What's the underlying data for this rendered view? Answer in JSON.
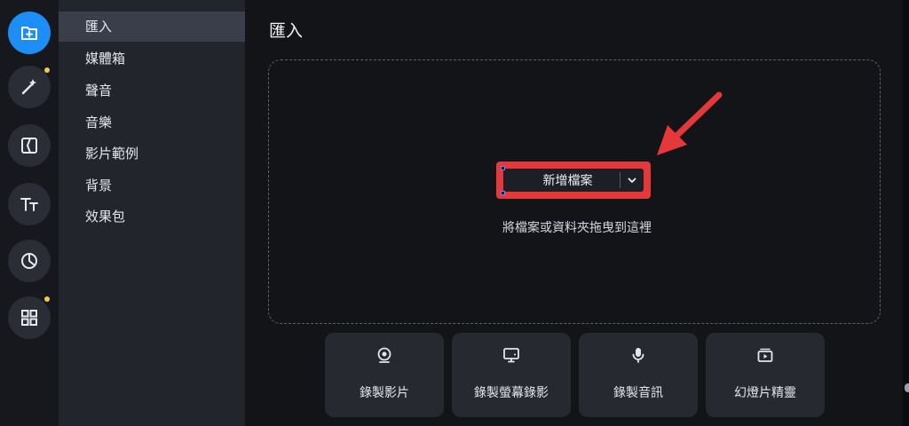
{
  "rail": {
    "items": [
      {
        "icon": "import-icon",
        "active": true
      },
      {
        "icon": "magic-wand-icon",
        "badge": true
      },
      {
        "icon": "transition-icon"
      },
      {
        "icon": "text-icon"
      },
      {
        "icon": "sticker-icon"
      },
      {
        "icon": "grid-icon",
        "badge": true
      }
    ],
    "accent": "#1e8ef7",
    "badge_color": "#f2c94c"
  },
  "categories": {
    "items": [
      {
        "label": "匯入"
      },
      {
        "label": "媒體箱"
      },
      {
        "label": "聲音"
      },
      {
        "label": "音樂"
      },
      {
        "label": "影片範例"
      },
      {
        "label": "背景"
      },
      {
        "label": "效果包"
      }
    ]
  },
  "main": {
    "title": "匯入",
    "add_button": {
      "label": "新增檔案",
      "icon": "chevron-down-icon"
    },
    "drop_hint": "將檔案或資料夾拖曳到這裡",
    "highlight_color": "#e5383b",
    "actions": [
      {
        "label": "錄製影片",
        "icon": "webcam-icon"
      },
      {
        "label": "錄製螢幕錄影",
        "icon": "monitor-icon"
      },
      {
        "label": "錄製音訊",
        "icon": "microphone-icon"
      },
      {
        "label": "幻燈片精靈",
        "icon": "slideshow-icon"
      }
    ]
  }
}
